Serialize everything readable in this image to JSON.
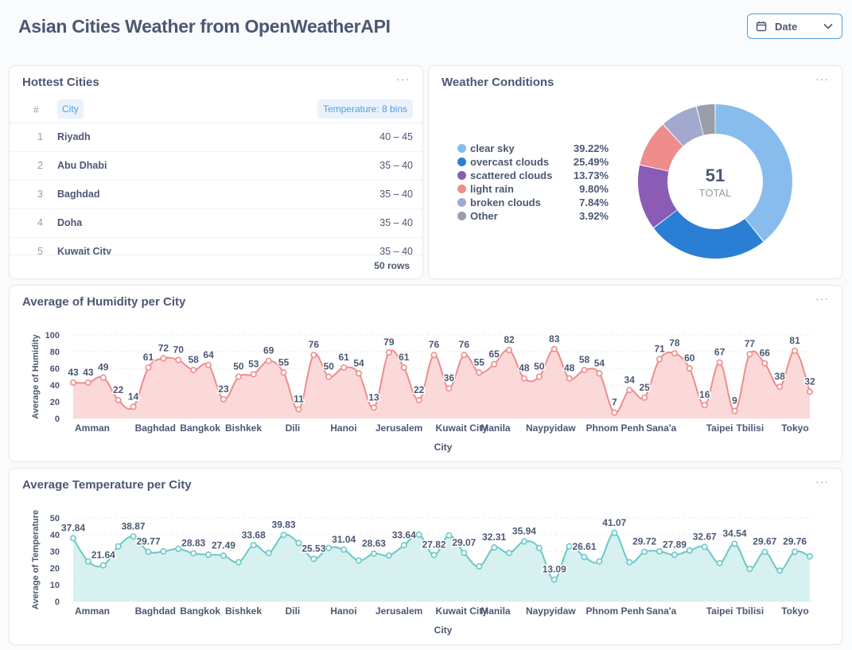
{
  "header": {
    "title": "Asian Cities Weather from OpenWeatherAPI",
    "date_filter_label": "Date"
  },
  "hottest": {
    "title": "Hottest Cities",
    "menu": "···",
    "columns": {
      "num": "#",
      "city": "City",
      "temp": "Temperature: 8 bins"
    },
    "rows": [
      {
        "num": "1",
        "city": "Riyadh",
        "temp": "40 – 45"
      },
      {
        "num": "2",
        "city": "Abu Dhabi",
        "temp": "35 – 40"
      },
      {
        "num": "3",
        "city": "Baghdad",
        "temp": "35 – 40"
      },
      {
        "num": "4",
        "city": "Doha",
        "temp": "35 – 40"
      },
      {
        "num": "5",
        "city": "Kuwait City",
        "temp": "35 – 40"
      }
    ],
    "footer": "50 rows"
  },
  "weather": {
    "title": "Weather Conditions",
    "menu": "···",
    "total_value": "51",
    "total_label": "TOTAL",
    "items": [
      {
        "name": "clear sky",
        "pct": "39.22%",
        "value": 39.22,
        "color": "#88bcec"
      },
      {
        "name": "overcast clouds",
        "pct": "25.49%",
        "value": 25.49,
        "color": "#2a7fd5"
      },
      {
        "name": "scattered clouds",
        "pct": "13.73%",
        "value": 13.73,
        "color": "#8a5cb5"
      },
      {
        "name": "light rain",
        "pct": "9.80%",
        "value": 9.8,
        "color": "#ef8c8c"
      },
      {
        "name": "broken clouds",
        "pct": "7.84%",
        "value": 7.84,
        "color": "#a3a8cf"
      },
      {
        "name": "Other",
        "pct": "3.92%",
        "value": 3.92,
        "color": "#9a9ea8"
      }
    ]
  },
  "humidity": {
    "title": "Average of Humidity per City",
    "menu": "···",
    "chart_data": {
      "type": "area",
      "xlabel": "City",
      "ylabel": "Average of Humidity",
      "ylim": [
        0,
        100
      ],
      "yticks": [
        0,
        20,
        40,
        60,
        80,
        100
      ],
      "color": "#ef8c8c",
      "fill": "#fbd9d9",
      "x_tick_labels": [
        {
          "i": 0,
          "label": "Amman"
        },
        {
          "i": 4,
          "label": "Baghdad"
        },
        {
          "i": 7,
          "label": "Bangkok"
        },
        {
          "i": 10,
          "label": "Bishkek"
        },
        {
          "i": 14,
          "label": "Dili"
        },
        {
          "i": 17,
          "label": "Hanoi"
        },
        {
          "i": 20,
          "label": "Jerusalem"
        },
        {
          "i": 24,
          "label": "Kuwait City"
        },
        {
          "i": 27,
          "label": "Manila"
        },
        {
          "i": 30,
          "label": "Naypyidaw"
        },
        {
          "i": 34,
          "label": "Phnom Penh"
        },
        {
          "i": 38,
          "label": "Sana'a"
        },
        {
          "i": 42,
          "label": "Taipei"
        },
        {
          "i": 44,
          "label": "Tbilisi"
        },
        {
          "i": 47,
          "label": "Tokyo"
        }
      ],
      "values": [
        43,
        43,
        49,
        22,
        14,
        61,
        72,
        70,
        58,
        64,
        23,
        50,
        53,
        69,
        55,
        11,
        76,
        50,
        61,
        54,
        13,
        79,
        61,
        22,
        76,
        36,
        76,
        55,
        65,
        82,
        48,
        50,
        83,
        48,
        58,
        54,
        7,
        34,
        25,
        71,
        78,
        60,
        16,
        67,
        9,
        77,
        66,
        38,
        81,
        32
      ],
      "labeled": [
        0,
        1,
        2,
        3,
        4,
        5,
        6,
        7,
        8,
        9,
        10,
        11,
        12,
        13,
        14,
        15,
        16,
        17,
        18,
        19,
        20,
        21,
        22,
        23,
        24,
        25,
        26,
        27,
        28,
        29,
        30,
        31,
        32,
        33,
        34,
        35,
        36,
        37,
        38,
        39,
        40,
        41,
        42,
        43,
        44,
        45,
        46,
        47,
        48,
        49
      ]
    }
  },
  "temperature": {
    "title": "Average Temperature per City",
    "menu": "···",
    "chart_data": {
      "type": "area",
      "xlabel": "City",
      "ylabel": "Average of Temperature",
      "ylim": [
        0,
        50
      ],
      "yticks": [
        0,
        10,
        20,
        30,
        40,
        50
      ],
      "color": "#69c8c8",
      "fill": "#d7f0f0",
      "x_tick_labels": [
        {
          "i": 0,
          "label": "Amman"
        },
        {
          "i": 4,
          "label": "Baghdad"
        },
        {
          "i": 7,
          "label": "Bangkok"
        },
        {
          "i": 10,
          "label": "Bishkek"
        },
        {
          "i": 14,
          "label": "Dili"
        },
        {
          "i": 17,
          "label": "Hanoi"
        },
        {
          "i": 20,
          "label": "Jerusalem"
        },
        {
          "i": 24,
          "label": "Kuwait City"
        },
        {
          "i": 27,
          "label": "Manila"
        },
        {
          "i": 30,
          "label": "Naypyidaw"
        },
        {
          "i": 34,
          "label": "Phnom Penh"
        },
        {
          "i": 38,
          "label": "Sana'a"
        },
        {
          "i": 42,
          "label": "Taipei"
        },
        {
          "i": 44,
          "label": "Tbilisi"
        },
        {
          "i": 47,
          "label": "Tokyo"
        }
      ],
      "values": [
        37.84,
        24,
        21.64,
        33,
        38.87,
        29.77,
        30,
        31.5,
        28.83,
        28,
        27.49,
        23.5,
        33.68,
        29,
        39.83,
        35,
        25.53,
        32,
        31.04,
        24.5,
        28.63,
        27.5,
        33.64,
        40,
        27.82,
        39.5,
        29.07,
        21,
        32.31,
        29,
        35.94,
        32,
        13.09,
        33,
        26.61,
        24,
        41.07,
        23.5,
        29.72,
        30,
        27.89,
        30.5,
        32.67,
        23,
        34.54,
        19.5,
        29.67,
        18.5,
        29.76,
        27
      ],
      "labeled": [
        0,
        2,
        4,
        5,
        8,
        10,
        12,
        14,
        16,
        18,
        20,
        22,
        24,
        26,
        28,
        30,
        32,
        34,
        36,
        38,
        40,
        42,
        44,
        46,
        48
      ]
    }
  }
}
